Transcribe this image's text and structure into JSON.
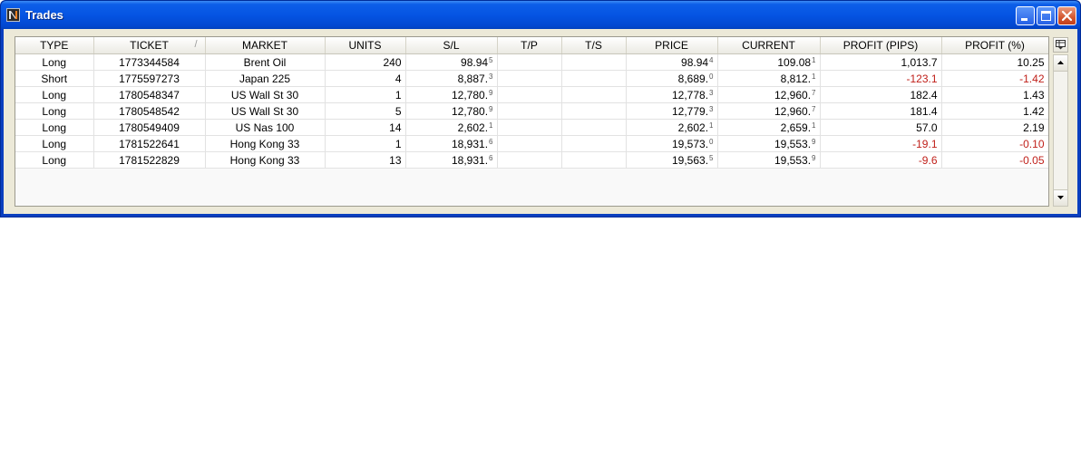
{
  "window": {
    "title": "Trades",
    "icon": "ninja-logo-icon",
    "controls": [
      "minimize-icon",
      "maximize-icon",
      "close-icon"
    ]
  },
  "colors": {
    "negative": "#c0201a",
    "titlebar": "#0554e3"
  },
  "table": {
    "sort_indicator": "/",
    "columns": [
      "TYPE",
      "TICKET",
      "MARKET",
      "UNITS",
      "S/L",
      "T/P",
      "T/S",
      "PRICE",
      "CURRENT",
      "PROFIT (PIPS)",
      "PROFIT (%)"
    ],
    "rows": [
      {
        "type": "Long",
        "ticket": "1773344584",
        "market": "Brent Oil",
        "units": "240",
        "sl": "98.94",
        "sl_sup": "5",
        "tp": "",
        "ts": "",
        "price": "98.94",
        "price_sup": "4",
        "current": "109.08",
        "current_sup": "1",
        "profit_pips": "1,013.7",
        "profit_pct": "10.25",
        "negative": false
      },
      {
        "type": "Short",
        "ticket": "1775597273",
        "market": "Japan 225",
        "units": "4",
        "sl": "8,887.",
        "sl_sup": "3",
        "tp": "",
        "ts": "",
        "price": "8,689.",
        "price_sup": "0",
        "current": "8,812.",
        "current_sup": "1",
        "profit_pips": "-123.1",
        "profit_pct": "-1.42",
        "negative": true
      },
      {
        "type": "Long",
        "ticket": "1780548347",
        "market": "US Wall St 30",
        "units": "1",
        "sl": "12,780.",
        "sl_sup": "9",
        "tp": "",
        "ts": "",
        "price": "12,778.",
        "price_sup": "3",
        "current": "12,960.",
        "current_sup": "7",
        "profit_pips": "182.4",
        "profit_pct": "1.43",
        "negative": false
      },
      {
        "type": "Long",
        "ticket": "1780548542",
        "market": "US Wall St 30",
        "units": "5",
        "sl": "12,780.",
        "sl_sup": "9",
        "tp": "",
        "ts": "",
        "price": "12,779.",
        "price_sup": "3",
        "current": "12,960.",
        "current_sup": "7",
        "profit_pips": "181.4",
        "profit_pct": "1.42",
        "negative": false
      },
      {
        "type": "Long",
        "ticket": "1780549409",
        "market": "US Nas 100",
        "units": "14",
        "sl": "2,602.",
        "sl_sup": "1",
        "tp": "",
        "ts": "",
        "price": "2,602.",
        "price_sup": "1",
        "current": "2,659.",
        "current_sup": "1",
        "profit_pips": "57.0",
        "profit_pct": "2.19",
        "negative": false
      },
      {
        "type": "Long",
        "ticket": "1781522641",
        "market": "Hong Kong 33",
        "units": "1",
        "sl": "18,931.",
        "sl_sup": "6",
        "tp": "",
        "ts": "",
        "price": "19,573.",
        "price_sup": "0",
        "current": "19,553.",
        "current_sup": "9",
        "profit_pips": "-19.1",
        "profit_pct": "-0.10",
        "negative": true
      },
      {
        "type": "Long",
        "ticket": "1781522829",
        "market": "Hong Kong 33",
        "units": "13",
        "sl": "18,931.",
        "sl_sup": "6",
        "tp": "",
        "ts": "",
        "price": "19,563.",
        "price_sup": "5",
        "current": "19,553.",
        "current_sup": "9",
        "profit_pips": "-9.6",
        "profit_pct": "-0.05",
        "negative": true
      }
    ]
  },
  "scrollbar": {
    "up_icon": "arrow-up-icon",
    "down_icon": "arrow-down-icon",
    "menu_icon": "column-chooser-icon"
  }
}
